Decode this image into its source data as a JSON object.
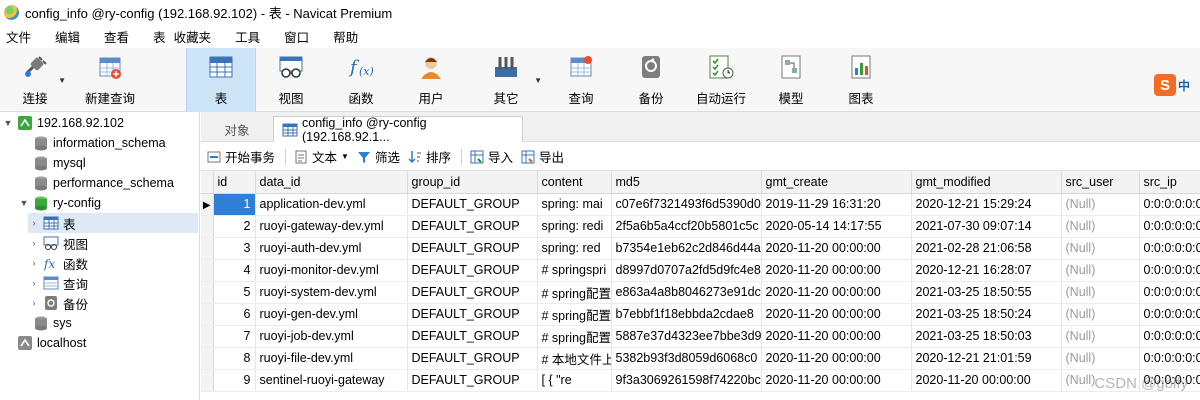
{
  "window": {
    "title": "config_info @ry-config (192.168.92.102) - 表 - Navicat Premium"
  },
  "menu": [
    "文件",
    "编辑",
    "查看",
    "表",
    "收藏夹",
    "工具",
    "窗口",
    "帮助"
  ],
  "toolbar": {
    "connect": "连接",
    "new_query": "新建查询",
    "table": "表",
    "view": "视图",
    "function": "函数",
    "user": "用户",
    "other": "其它",
    "query": "查询",
    "backup": "备份",
    "automation": "自动运行",
    "model": "模型",
    "chart": "图表"
  },
  "ime": {
    "label": "中"
  },
  "tree": {
    "server1": "192.168.92.102",
    "db_information_schema": "information_schema",
    "db_mysql": "mysql",
    "db_performance_schema": "performance_schema",
    "db_ry_config": "ry-config",
    "node_table": "表",
    "node_view": "视图",
    "node_function": "函数",
    "node_query": "查询",
    "node_backup": "备份",
    "db_sys": "sys",
    "server2": "localhost"
  },
  "tabs": {
    "objects": "对象",
    "active": "config_info @ry-config (192.168.92.1..."
  },
  "subtoolbar": {
    "begin_tx": "开始事务",
    "text": "文本",
    "filter": "筛选",
    "sort": "排序",
    "import": "导入",
    "export": "导出"
  },
  "table": {
    "columns": [
      "id",
      "data_id",
      "group_id",
      "content",
      "md5",
      "gmt_create",
      "gmt_modified",
      "src_user",
      "src_ip"
    ],
    "rows": [
      [
        "1",
        "application-dev.yml",
        "DEFAULT_GROUP",
        "spring:  mai",
        "c07e6f7321493f6d5390d0",
        "2019-11-29 16:31:20",
        "2020-12-21 15:29:24",
        "(Null)",
        "0:0:0:0:0:0"
      ],
      [
        "2",
        "ruoyi-gateway-dev.yml",
        "DEFAULT_GROUP",
        "spring:  redi",
        "2f5a6b5a4ccf20b5801c5c",
        "2020-05-14 14:17:55",
        "2021-07-30 09:07:14",
        "(Null)",
        "0:0:0:0:0:0"
      ],
      [
        "3",
        "ruoyi-auth-dev.yml",
        "DEFAULT_GROUP",
        "spring:    red",
        "b7354e1eb62c2d846d44a",
        "2020-11-20 00:00:00",
        "2021-02-28 21:06:58",
        "(Null)",
        "0:0:0:0:0:0"
      ],
      [
        "4",
        "ruoyi-monitor-dev.yml",
        "DEFAULT_GROUP",
        "# springspri",
        "d8997d0707a2fd5d9fc4e8",
        "2020-11-20 00:00:00",
        "2020-12-21 16:28:07",
        "(Null)",
        "0:0:0:0:0:0"
      ],
      [
        "5",
        "ruoyi-system-dev.yml",
        "DEFAULT_GROUP",
        "# spring配置",
        "e863a4a8b8046273e91dc",
        "2020-11-20 00:00:00",
        "2021-03-25 18:50:55",
        "(Null)",
        "0:0:0:0:0:0"
      ],
      [
        "6",
        "ruoyi-gen-dev.yml",
        "DEFAULT_GROUP",
        "# spring配置",
        "b7ebbf1f18ebbda2cdae8",
        "2020-11-20 00:00:00",
        "2021-03-25 18:50:24",
        "(Null)",
        "0:0:0:0:0:0"
      ],
      [
        "7",
        "ruoyi-job-dev.yml",
        "DEFAULT_GROUP",
        "# spring配置",
        "5887e37d4323ee7bbe3d9",
        "2020-11-20 00:00:00",
        "2021-03-25 18:50:03",
        "(Null)",
        "0:0:0:0:0:0"
      ],
      [
        "8",
        "ruoyi-file-dev.yml",
        "DEFAULT_GROUP",
        "# 本地文件上",
        "5382b93f3d8059d6068c0",
        "2020-11-20 00:00:00",
        "2020-12-21 21:01:59",
        "(Null)",
        "0:0:0:0:0:0"
      ],
      [
        "9",
        "sentinel-ruoyi-gateway",
        "DEFAULT_GROUP",
        "[    {        \"re",
        "9f3a3069261598f74220bc",
        "2020-11-20 00:00:00",
        "2020-11-20 00:00:00",
        "(Null)",
        "0:0:0:0:0:0"
      ]
    ]
  },
  "watermark": "CSDN @gblfy",
  "colors": {
    "selection": "#2f7fd6",
    "active_tool": "#cde4f7",
    "null_text": "#9a9a9a"
  }
}
